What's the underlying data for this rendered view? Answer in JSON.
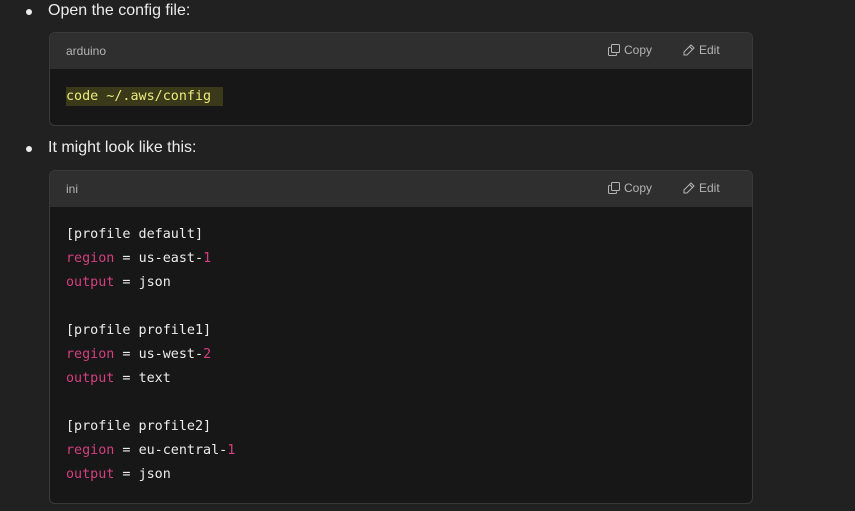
{
  "bullets": [
    "Open the config file:",
    "It might look like this:"
  ],
  "blocks": [
    {
      "lang": "arduino",
      "copy_label": "Copy",
      "edit_label": "Edit",
      "command": "code ~/.aws/config"
    },
    {
      "lang": "ini",
      "copy_label": "Copy",
      "edit_label": "Edit",
      "sections": [
        {
          "header": "[profile default]",
          "region_key": "region",
          "region_val": "us-east-",
          "region_num": "1",
          "output_key": "output",
          "output_val": "json"
        },
        {
          "header": "[profile profile1]",
          "region_key": "region",
          "region_val": "us-west-",
          "region_num": "2",
          "output_key": "output",
          "output_val": "text"
        },
        {
          "header": "[profile profile2]",
          "region_key": "region",
          "region_val": "eu-central-",
          "region_num": "1",
          "output_key": "output",
          "output_val": "json"
        }
      ]
    }
  ],
  "equals": " = ",
  "icons": {
    "copy": "copy-icon",
    "edit": "pencil-icon"
  },
  "colors": {
    "background": "#212121",
    "code_bg": "#171717",
    "header_bg": "#2f2f2f",
    "key_color": "#d33f7f",
    "highlight": "#ecec7a"
  }
}
